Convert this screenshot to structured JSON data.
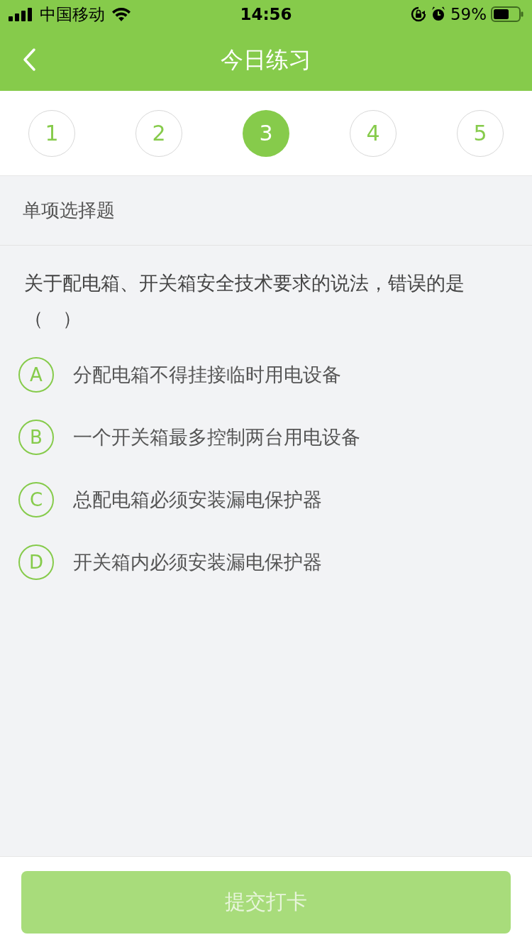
{
  "status_bar": {
    "carrier": "中国移动",
    "time": "14:56",
    "battery": "59%"
  },
  "nav": {
    "title": "今日练习"
  },
  "question_numbers": [
    {
      "label": "1",
      "selected": false
    },
    {
      "label": "2",
      "selected": false
    },
    {
      "label": "3",
      "selected": true
    },
    {
      "label": "4",
      "selected": false
    },
    {
      "label": "5",
      "selected": false
    }
  ],
  "section": "单项选择题",
  "question": "关于配电箱、开关箱安全技术要求的说法，错误的是（　）",
  "options": [
    {
      "letter": "A",
      "text": "分配电箱不得挂接临时用电设备",
      "selected": false
    },
    {
      "letter": "B",
      "text": "一个开关箱最多控制两台用电设备",
      "selected": false
    },
    {
      "letter": "C",
      "text": "总配电箱必须安装漏电保护器",
      "selected": false
    },
    {
      "letter": "D",
      "text": "开关箱内必须安装漏电保护器",
      "selected": false
    }
  ],
  "submit": {
    "label": "提交打卡",
    "disabled": true
  }
}
